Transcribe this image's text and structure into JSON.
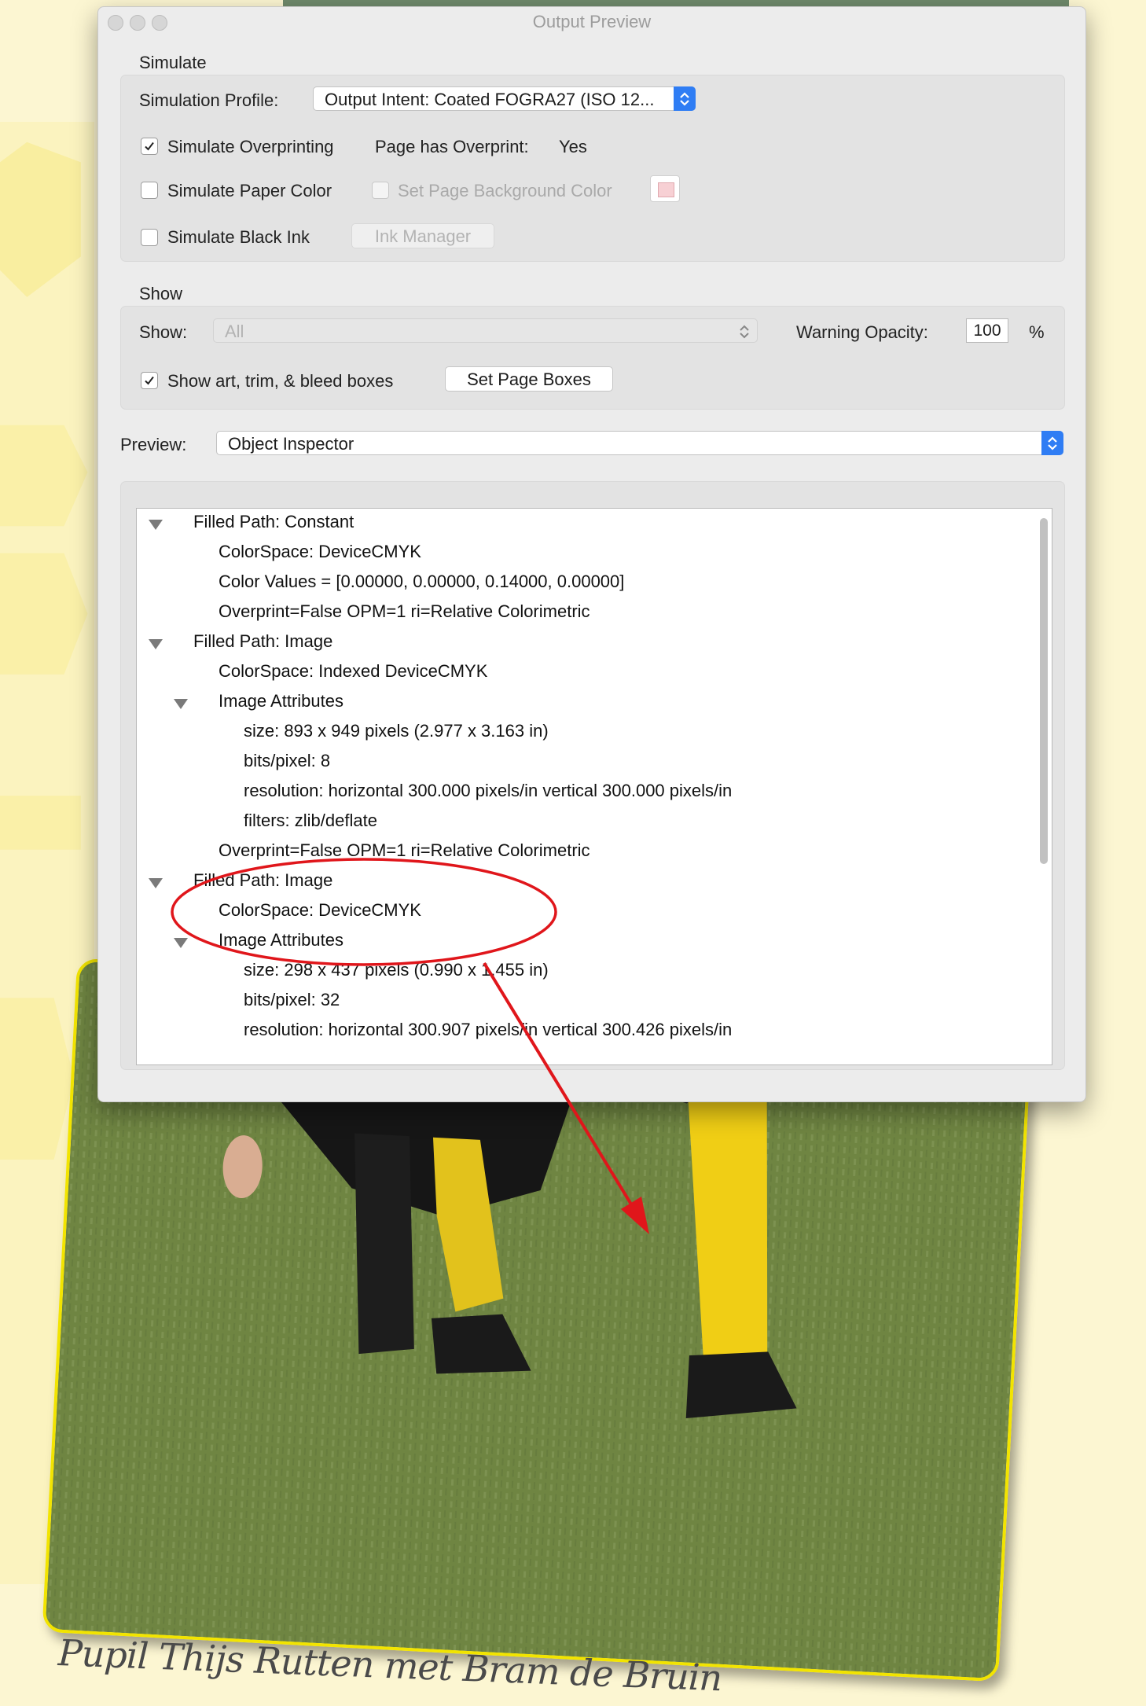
{
  "window": {
    "title": "Output Preview"
  },
  "simulate": {
    "section_label": "Simulate",
    "profile_label": "Simulation Profile:",
    "profile_value": "Output Intent: Coated FOGRA27 (ISO 12...",
    "overprinting_label": "Simulate Overprinting",
    "overprinting_checked": true,
    "page_overprint_label": "Page has Overprint:",
    "page_overprint_value": "Yes",
    "paper_color_label": "Simulate Paper Color",
    "paper_color_checked": false,
    "page_bg_label": "Set Page Background Color",
    "page_bg_checked": false,
    "black_ink_label": "Simulate Black Ink",
    "black_ink_checked": false,
    "ink_manager_label": "Ink Manager"
  },
  "show": {
    "section_label": "Show",
    "show_label": "Show:",
    "show_value": "All",
    "warning_opacity_label": "Warning Opacity:",
    "warning_opacity_value": "100",
    "percent_sign": "%",
    "boxes_label": "Show art, trim, & bleed boxes",
    "boxes_checked": true,
    "set_page_boxes_label": "Set Page Boxes"
  },
  "preview": {
    "label": "Preview:",
    "value": "Object Inspector"
  },
  "tree": [
    {
      "text": "Filled Path: Constant",
      "level": 0,
      "expanded": true
    },
    {
      "text": "ColorSpace: DeviceCMYK",
      "level": 1
    },
    {
      "text": "Color Values = [0.00000, 0.00000, 0.14000, 0.00000]",
      "level": 1
    },
    {
      "text": "Overprint=False OPM=1 ri=Relative Colorimetric",
      "level": 1
    },
    {
      "text": "Filled Path: Image",
      "level": 0,
      "expanded": true
    },
    {
      "text": "ColorSpace: Indexed DeviceCMYK",
      "level": 1
    },
    {
      "text": "Image Attributes",
      "level": 1,
      "expanded": true
    },
    {
      "text": "size: 893 x 949 pixels (2.977 x 3.163 in)",
      "level": 2
    },
    {
      "text": "bits/pixel: 8",
      "level": 2
    },
    {
      "text": "resolution: horizontal 300.000 pixels/in vertical 300.000 pixels/in",
      "level": 2
    },
    {
      "text": "filters: zlib/deflate",
      "level": 2
    },
    {
      "text": "Overprint=False OPM=1 ri=Relative Colorimetric",
      "level": 1
    },
    {
      "text": "Filled Path: Image",
      "level": 0,
      "expanded": true
    },
    {
      "text": "ColorSpace: DeviceCMYK",
      "level": 1
    },
    {
      "text": "Image Attributes",
      "level": 1,
      "expanded": true
    },
    {
      "text": "size: 298 x 437 pixels (0.990 x 1.455 in)",
      "level": 2
    },
    {
      "text": "bits/pixel: 32",
      "level": 2
    },
    {
      "text": "resolution: horizontal 300.907 pixels/in vertical 300.426 pixels/in",
      "level": 2
    }
  ],
  "caption": "Pupil Thijs Rutten met Bram de Bruin",
  "colors": {
    "accent_blue": "#2f7df4",
    "annotation_red": "#e0161b",
    "card_border_yellow": "#f2e400",
    "page_background": "#fdf7cc"
  }
}
